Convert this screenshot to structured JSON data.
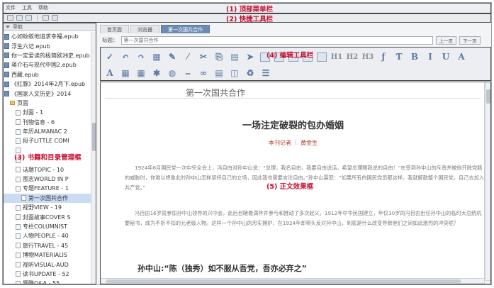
{
  "menu": [
    "文件",
    "工具",
    "帮助"
  ],
  "annotations": {
    "menubar": "(1) 顶部菜单栏",
    "quickbar": "(2) 快捷工具栏",
    "sidebar": "(3) 书籍和目录管理框",
    "edit_toolbar": "(4) 编辑工具栏",
    "doc": "(5) 正文效果框"
  },
  "sidebar": {
    "header": "导航",
    "items": [
      {
        "label": "心如蚊蚁地追求幸福.epub",
        "type": "book",
        "indent": 1
      },
      {
        "label": "浮生六记.epub",
        "type": "book",
        "indent": 1
      },
      {
        "label": "你一定爱读的极简欧洲史.epub",
        "type": "book",
        "indent": 1
      },
      {
        "label": "蒋介石与现代中国2.epub",
        "type": "book",
        "indent": 1
      },
      {
        "label": "西藏.epub",
        "type": "book",
        "indent": 1
      },
      {
        "label": "《红豚》2014年2月下.epub",
        "type": "book",
        "indent": 1
      },
      {
        "label": "《国家人文历史》2014",
        "type": "book",
        "indent": 1
      },
      {
        "label": "页面",
        "type": "folder",
        "indent": 2
      },
      {
        "label": "封面 - 1",
        "type": "page",
        "indent": 3
      },
      {
        "label": "刊物信息 - 6",
        "type": "page",
        "indent": 3
      },
      {
        "label": "年历ALMANAC 2",
        "type": "page",
        "indent": 3
      },
      {
        "label": "段子LITTLE COMI",
        "type": "page",
        "indent": 3
      },
      {
        "label": "",
        "type": "page",
        "indent": 3
      },
      {
        "label": "",
        "type": "page",
        "indent": 3
      },
      {
        "label": "话题TOPIC - 10",
        "type": "page",
        "indent": 3
      },
      {
        "label": "图志WORLD IN P",
        "type": "page",
        "indent": 3
      },
      {
        "label": "专题FEATURE - 1",
        "type": "page",
        "indent": 3
      },
      {
        "label": "第一次国共合作",
        "type": "page",
        "indent": 4,
        "selected": true
      },
      {
        "label": "视野VIEW - 19",
        "type": "page",
        "indent": 3
      },
      {
        "label": "封面故事COVER S",
        "type": "page",
        "indent": 3
      },
      {
        "label": "专栏COLUMNIST",
        "type": "page",
        "indent": 3
      },
      {
        "label": "人物PEOPLE - 40",
        "type": "page",
        "indent": 3
      },
      {
        "label": "旅行TRAVEL - 45",
        "type": "page",
        "indent": 3
      },
      {
        "label": "博物MATERIALIS",
        "type": "page",
        "indent": 3
      },
      {
        "label": "视听VISUAL-AUD",
        "type": "page",
        "indent": 3
      },
      {
        "label": "读书UPDATE - 52",
        "type": "page",
        "indent": 3
      },
      {
        "label": "题酷Q&A - 55",
        "type": "page",
        "indent": 3
      }
    ]
  },
  "tabs": [
    {
      "label": "首页面",
      "active": false
    },
    {
      "label": "浏览器",
      "active": false
    },
    {
      "label": "第一次国共合作",
      "active": true
    }
  ],
  "titlebar": {
    "label": "标题：",
    "value": "第一次国共合作",
    "prev": "上一页",
    "next": "下一页"
  },
  "toolbar": {
    "row1": [
      "✓",
      "↶",
      "↷",
      "▦",
      "✎",
      "⁄",
      "✂",
      "⎘",
      "▤",
      "➤",
      "",
      "",
      "",
      "",
      "",
      "H1",
      "H2",
      "H3",
      "ƒ",
      "Ƭ",
      "B",
      "I",
      "U",
      "A"
    ],
    "row2": [
      "A",
      "▦",
      "▦",
      "✱",
      "◍",
      "⎯",
      "∞",
      "▤",
      "◫",
      "♻",
      "☰"
    ]
  },
  "doc": {
    "chapter": "第一次国共合作",
    "title": "一场注定破裂的包办婚姻",
    "byline": "本刊记者 ｜ 黄金生",
    "paragraphs": [
      "1924年6月国民党一次中央全会上，冯自由对孙中山说：“总理，我名自由，我要自由说话，希望总理赐我说的自由！”在受到孙中山的斥责并被他开除党籍的威胁时，你难以想象此时孙中山怎样坚持自己的立场，因此我也需要言论自由。”孙中山震怒：“如果所有的国民党员都这样，我就解散整个国民党，自己去加入共产党。”",
      "冯自由16岁就参加孙中山领导的兴中会，此后目睹着满怀并参与和推动了多次起义。1912年中华民国建立，年仅30岁的冯自由出任孙中山的临时大总统机要秘书，成为不折不扣的元老级人物。这样一个孙中山的忠实拥护，在1924年却带头反对孙中山，到底是什么改变导致他们之间如此激烈的冲突呢？"
    ],
    "subhead": "孙中山:“陈（独秀）如不服从吾党，吾亦必弃之”"
  }
}
